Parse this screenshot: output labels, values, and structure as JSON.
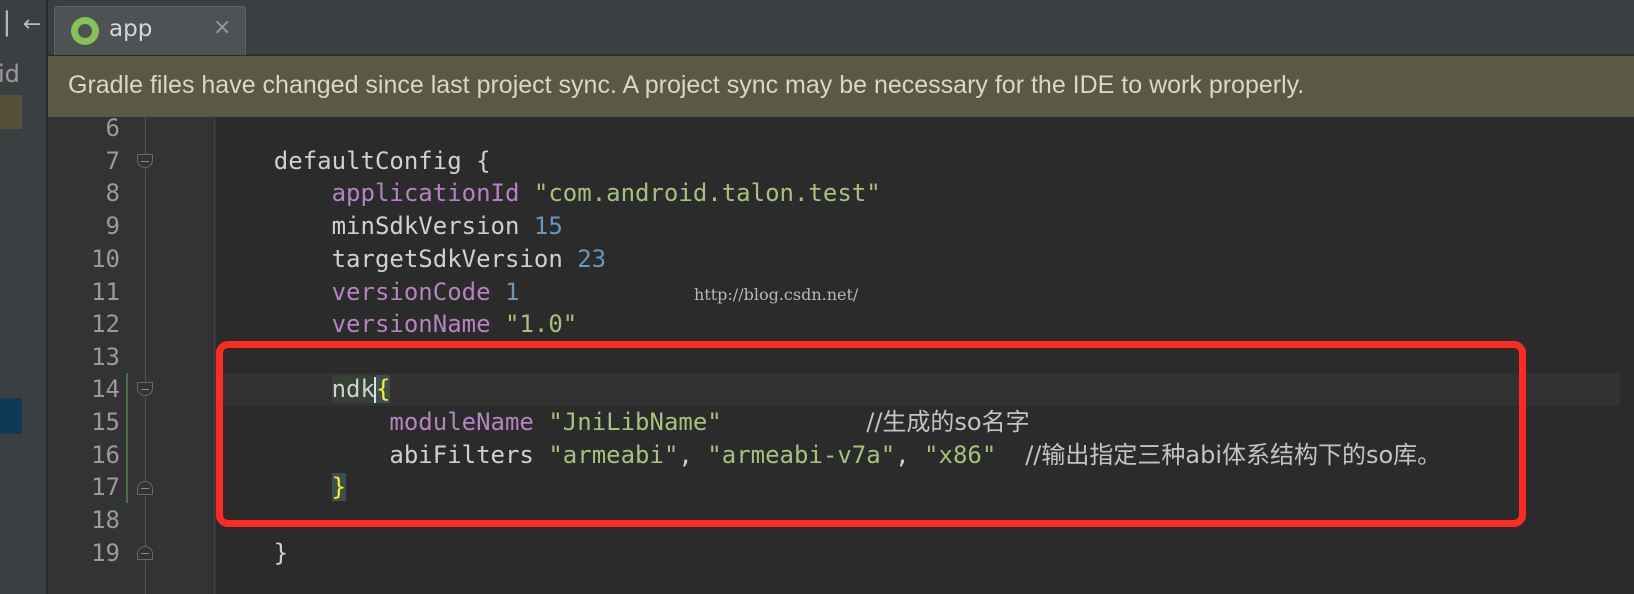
{
  "left_strip": {
    "collapse_glyph": "▏←",
    "partial_label": "id"
  },
  "tabs": [
    {
      "label": "app",
      "close": "×",
      "icon": "gradle-app-icon"
    }
  ],
  "banner": {
    "text": "Gradle files have changed since last project sync. A project sync may be necessary for the IDE to work properly."
  },
  "editor": {
    "line_numbers": [
      "6",
      "7",
      "8",
      "9",
      "10",
      "11",
      "12",
      "13",
      "14",
      "15",
      "16",
      "17",
      "18",
      "19"
    ],
    "code": {
      "l7": {
        "kw": "defaultConfig",
        "brace": " {"
      },
      "l8": {
        "prop": "applicationId",
        "str": "\"com.android.talon.test\""
      },
      "l9": {
        "kw": "minSdkVersion",
        "num": "15"
      },
      "l10": {
        "kw": "targetSdkVersion",
        "num": "23"
      },
      "l11": {
        "prop": "versionCode",
        "num": "1"
      },
      "l12": {
        "prop": "versionName",
        "str": "\"1.0\""
      },
      "l14": {
        "kw": "ndk",
        "brace": "{"
      },
      "l15": {
        "prop": "moduleName",
        "str": "\"JniLibName\"",
        "comment": "//生成的so名字"
      },
      "l16": {
        "kw": "abiFilters",
        "s1": "\"armeabi\"",
        "s2": "\"armeabi-v7a\"",
        "s3": "\"x86\"",
        "sep": ", ",
        "comment": "//输出指定三种abi体系结构下的so库。"
      },
      "l17": {
        "brace": "}"
      },
      "l19": {
        "brace": "}"
      }
    },
    "watermark": "http://blog.csdn.net/"
  },
  "colors": {
    "background": "#2b2b2b",
    "gutter": "#313335",
    "banner": "#5a5946",
    "highlight_box": "#ff2a22",
    "string": "#a5c17c",
    "number": "#6897bb",
    "property": "#b582c2",
    "brace_match": "#ffef28"
  }
}
